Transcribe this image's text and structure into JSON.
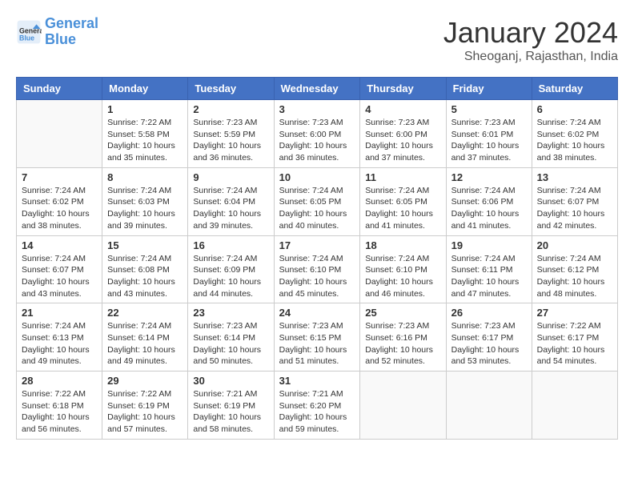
{
  "header": {
    "logo_line1": "General",
    "logo_line2": "Blue",
    "month": "January 2024",
    "location": "Sheoganj, Rajasthan, India"
  },
  "days_of_week": [
    "Sunday",
    "Monday",
    "Tuesday",
    "Wednesday",
    "Thursday",
    "Friday",
    "Saturday"
  ],
  "weeks": [
    [
      {
        "day": "",
        "info": ""
      },
      {
        "day": "1",
        "info": "Sunrise: 7:22 AM\nSunset: 5:58 PM\nDaylight: 10 hours\nand 35 minutes."
      },
      {
        "day": "2",
        "info": "Sunrise: 7:23 AM\nSunset: 5:59 PM\nDaylight: 10 hours\nand 36 minutes."
      },
      {
        "day": "3",
        "info": "Sunrise: 7:23 AM\nSunset: 6:00 PM\nDaylight: 10 hours\nand 36 minutes."
      },
      {
        "day": "4",
        "info": "Sunrise: 7:23 AM\nSunset: 6:00 PM\nDaylight: 10 hours\nand 37 minutes."
      },
      {
        "day": "5",
        "info": "Sunrise: 7:23 AM\nSunset: 6:01 PM\nDaylight: 10 hours\nand 37 minutes."
      },
      {
        "day": "6",
        "info": "Sunrise: 7:24 AM\nSunset: 6:02 PM\nDaylight: 10 hours\nand 38 minutes."
      }
    ],
    [
      {
        "day": "7",
        "info": "Sunrise: 7:24 AM\nSunset: 6:02 PM\nDaylight: 10 hours\nand 38 minutes."
      },
      {
        "day": "8",
        "info": "Sunrise: 7:24 AM\nSunset: 6:03 PM\nDaylight: 10 hours\nand 39 minutes."
      },
      {
        "day": "9",
        "info": "Sunrise: 7:24 AM\nSunset: 6:04 PM\nDaylight: 10 hours\nand 39 minutes."
      },
      {
        "day": "10",
        "info": "Sunrise: 7:24 AM\nSunset: 6:05 PM\nDaylight: 10 hours\nand 40 minutes."
      },
      {
        "day": "11",
        "info": "Sunrise: 7:24 AM\nSunset: 6:05 PM\nDaylight: 10 hours\nand 41 minutes."
      },
      {
        "day": "12",
        "info": "Sunrise: 7:24 AM\nSunset: 6:06 PM\nDaylight: 10 hours\nand 41 minutes."
      },
      {
        "day": "13",
        "info": "Sunrise: 7:24 AM\nSunset: 6:07 PM\nDaylight: 10 hours\nand 42 minutes."
      }
    ],
    [
      {
        "day": "14",
        "info": "Sunrise: 7:24 AM\nSunset: 6:07 PM\nDaylight: 10 hours\nand 43 minutes."
      },
      {
        "day": "15",
        "info": "Sunrise: 7:24 AM\nSunset: 6:08 PM\nDaylight: 10 hours\nand 43 minutes."
      },
      {
        "day": "16",
        "info": "Sunrise: 7:24 AM\nSunset: 6:09 PM\nDaylight: 10 hours\nand 44 minutes."
      },
      {
        "day": "17",
        "info": "Sunrise: 7:24 AM\nSunset: 6:10 PM\nDaylight: 10 hours\nand 45 minutes."
      },
      {
        "day": "18",
        "info": "Sunrise: 7:24 AM\nSunset: 6:10 PM\nDaylight: 10 hours\nand 46 minutes."
      },
      {
        "day": "19",
        "info": "Sunrise: 7:24 AM\nSunset: 6:11 PM\nDaylight: 10 hours\nand 47 minutes."
      },
      {
        "day": "20",
        "info": "Sunrise: 7:24 AM\nSunset: 6:12 PM\nDaylight: 10 hours\nand 48 minutes."
      }
    ],
    [
      {
        "day": "21",
        "info": "Sunrise: 7:24 AM\nSunset: 6:13 PM\nDaylight: 10 hours\nand 49 minutes."
      },
      {
        "day": "22",
        "info": "Sunrise: 7:24 AM\nSunset: 6:14 PM\nDaylight: 10 hours\nand 49 minutes."
      },
      {
        "day": "23",
        "info": "Sunrise: 7:23 AM\nSunset: 6:14 PM\nDaylight: 10 hours\nand 50 minutes."
      },
      {
        "day": "24",
        "info": "Sunrise: 7:23 AM\nSunset: 6:15 PM\nDaylight: 10 hours\nand 51 minutes."
      },
      {
        "day": "25",
        "info": "Sunrise: 7:23 AM\nSunset: 6:16 PM\nDaylight: 10 hours\nand 52 minutes."
      },
      {
        "day": "26",
        "info": "Sunrise: 7:23 AM\nSunset: 6:17 PM\nDaylight: 10 hours\nand 53 minutes."
      },
      {
        "day": "27",
        "info": "Sunrise: 7:22 AM\nSunset: 6:17 PM\nDaylight: 10 hours\nand 54 minutes."
      }
    ],
    [
      {
        "day": "28",
        "info": "Sunrise: 7:22 AM\nSunset: 6:18 PM\nDaylight: 10 hours\nand 56 minutes."
      },
      {
        "day": "29",
        "info": "Sunrise: 7:22 AM\nSunset: 6:19 PM\nDaylight: 10 hours\nand 57 minutes."
      },
      {
        "day": "30",
        "info": "Sunrise: 7:21 AM\nSunset: 6:19 PM\nDaylight: 10 hours\nand 58 minutes."
      },
      {
        "day": "31",
        "info": "Sunrise: 7:21 AM\nSunset: 6:20 PM\nDaylight: 10 hours\nand 59 minutes."
      },
      {
        "day": "",
        "info": ""
      },
      {
        "day": "",
        "info": ""
      },
      {
        "day": "",
        "info": ""
      }
    ]
  ]
}
